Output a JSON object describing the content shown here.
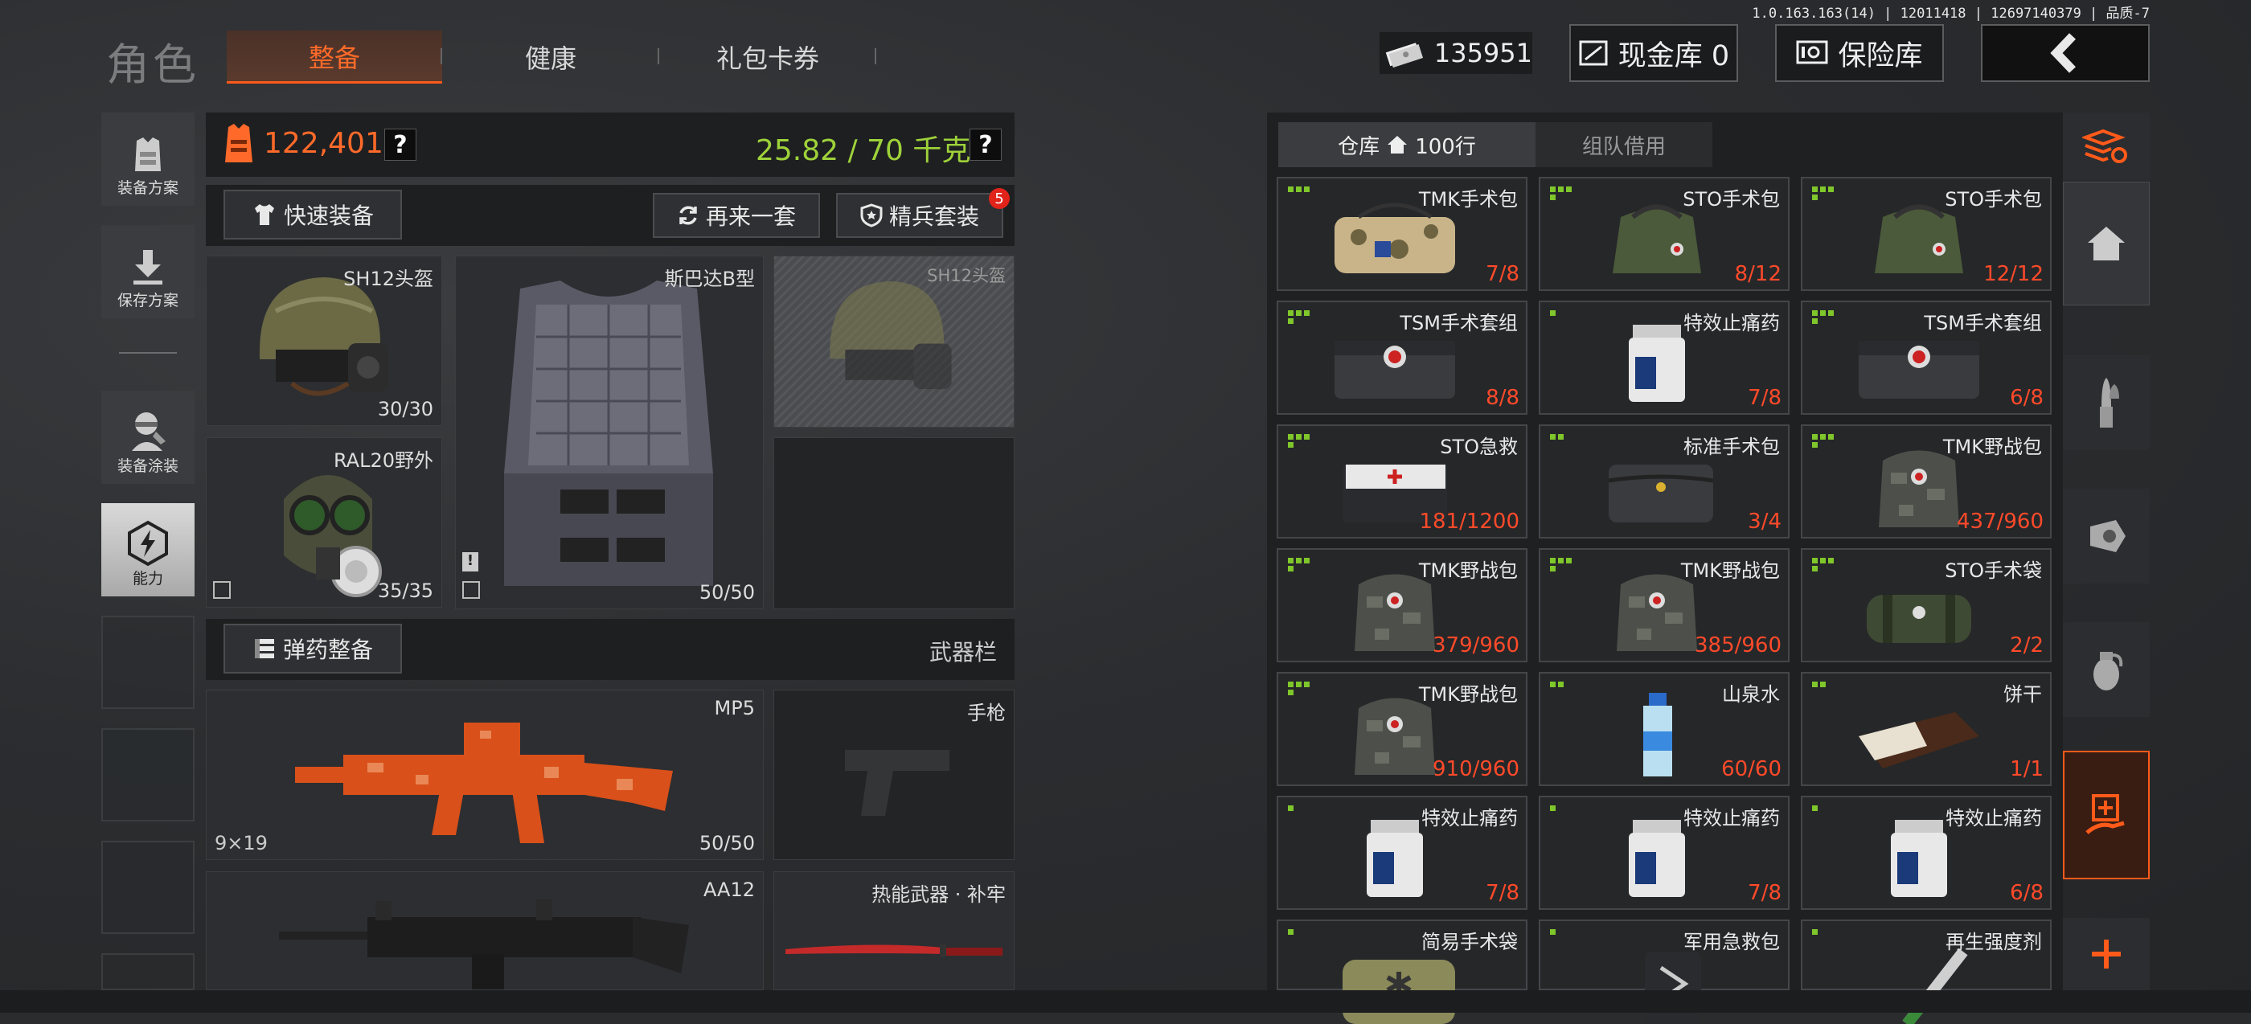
{
  "version": "1.0.163.163(14) | 12011418 | 12697140379 | 品质-7",
  "title": "角色",
  "tabs": [
    {
      "label": "整备",
      "active": true
    },
    {
      "label": "健康",
      "active": false
    },
    {
      "label": "礼包卡券",
      "active": false
    }
  ],
  "money": "135951",
  "cash_vault": "现金库 0",
  "safe_vault": "保险库",
  "sidebar": {
    "items": [
      {
        "label": "装备方案"
      },
      {
        "label": "保存方案"
      },
      {
        "label": "装备涂装"
      },
      {
        "label": "能力"
      }
    ]
  },
  "loadout": {
    "value": "122,401",
    "weight": "25.82 / 70 千克",
    "quick_equip": "快速装备",
    "again": "再来一套",
    "elite": "精兵套装",
    "elite_badge": "5",
    "ammo": "弹药整备",
    "weapon_bar": "武器栏"
  },
  "gear": {
    "helmet": {
      "name": "SH12头盔",
      "dur": "30/30"
    },
    "armor": {
      "name": "斯巴达B型",
      "dur": "50/50"
    },
    "helmet_ghost": {
      "name": "SH12头盔"
    },
    "mask": {
      "name": "RAL20野外",
      "dur": "35/35"
    }
  },
  "weapons": {
    "primary": {
      "name": "MP5",
      "ammo": "9×19",
      "dur": "50/50"
    },
    "pistol": {
      "name": "手枪"
    },
    "secondary": {
      "name": "AA12"
    },
    "melee": {
      "name": "热能武器 · 补牢"
    }
  },
  "storage": {
    "tab_storage": "仓库",
    "rows": "100行",
    "tab_team": "组队借用",
    "items": [
      {
        "name": "TMK手术包",
        "count": "7/8",
        "dots": 3,
        "art": "camobag"
      },
      {
        "name": "STO手术包",
        "count": "8/12",
        "dots": 4,
        "art": "greenbag"
      },
      {
        "name": "STO手术包",
        "count": "12/12",
        "dots": 4,
        "art": "greenbag"
      },
      {
        "name": "TSM手术套组",
        "count": "8/8",
        "dots": 4,
        "art": "blackbag"
      },
      {
        "name": "特效止痛药",
        "count": "7/8",
        "dots": 1,
        "art": "bottle"
      },
      {
        "name": "TSM手术套组",
        "count": "6/8",
        "dots": 4,
        "art": "blackbag"
      },
      {
        "name": "STO急救",
        "count": "181/1200",
        "dots": 4,
        "art": "case"
      },
      {
        "name": "标准手术包",
        "count": "3/4",
        "dots": 2,
        "art": "pouch"
      },
      {
        "name": "TMK野战包",
        "count": "437/960",
        "dots": 4,
        "art": "backpack"
      },
      {
        "name": "TMK野战包",
        "count": "379/960",
        "dots": 4,
        "art": "backpack"
      },
      {
        "name": "TMK野战包",
        "count": "385/960",
        "dots": 4,
        "art": "backpack"
      },
      {
        "name": "STO手术袋",
        "count": "2/2",
        "dots": 4,
        "art": "greenroll"
      },
      {
        "name": "TMK野战包",
        "count": "910/960",
        "dots": 4,
        "art": "backpack"
      },
      {
        "name": "山泉水",
        "count": "60/60",
        "dots": 2,
        "art": "water"
      },
      {
        "name": "饼干",
        "count": "1/1",
        "dots": 2,
        "art": "biscuit"
      },
      {
        "name": "特效止痛药",
        "count": "7/8",
        "dots": 1,
        "art": "bottle"
      },
      {
        "name": "特效止痛药",
        "count": "7/8",
        "dots": 1,
        "art": "bottle"
      },
      {
        "name": "特效止痛药",
        "count": "6/8",
        "dots": 1,
        "art": "bottle"
      },
      {
        "name": "简易手术袋",
        "count": "",
        "dots": 1,
        "art": "bag2"
      },
      {
        "name": "军用急救包",
        "count": "",
        "dots": 1,
        "art": "kit"
      },
      {
        "name": "再生强度剂",
        "count": "",
        "dots": 1,
        "art": "syringe"
      }
    ]
  },
  "colors": {
    "accent": "#ff5a1a",
    "weight": "#9ed23a",
    "count": "#ff4a2a",
    "dot": "#7fc72a"
  }
}
